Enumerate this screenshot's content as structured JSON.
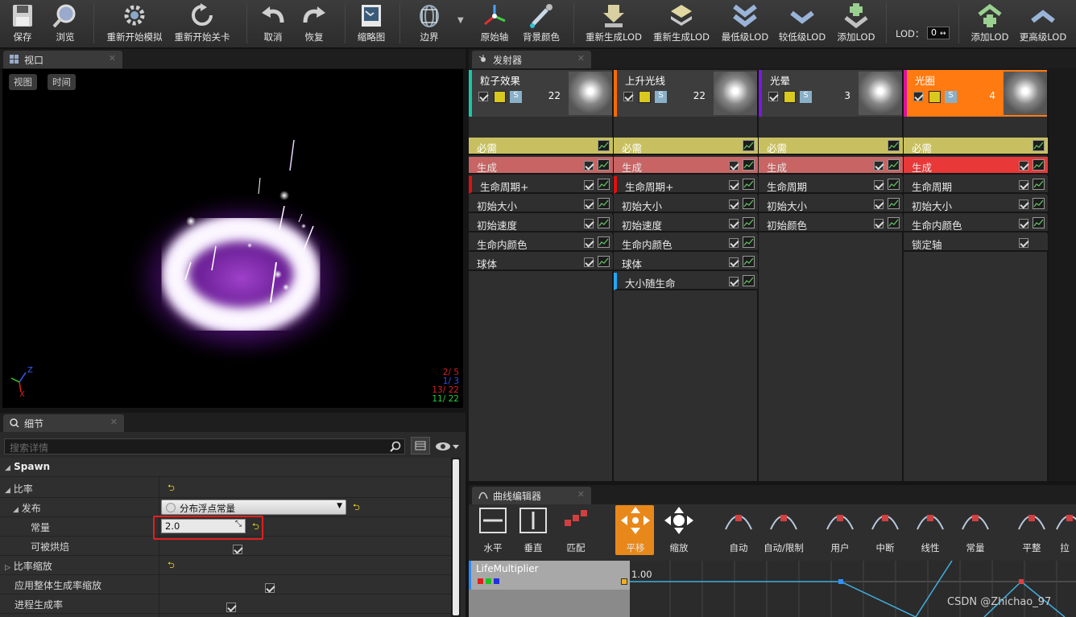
{
  "toolbar": {
    "save": "保存",
    "browse": "浏览",
    "restart_sim": "重新开始模拟",
    "restart_level": "重新开始关卡",
    "undo": "取消",
    "redo": "恢复",
    "thumbnail": "缩略图",
    "bounds": "边界",
    "origin_axis": "原始轴",
    "bg_color": "背景颜色",
    "regen_lod1": "重新生成LOD",
    "regen_lod2": "重新生成LOD",
    "lowest_lod": "最低级LOD",
    "lower_lod": "较低级LOD",
    "add_lod1": "添加LOD",
    "lod_label": "LOD：",
    "lod_value": "0",
    "add_lod2": "添加LOD",
    "higher_lod": "更高级LOD"
  },
  "viewport": {
    "tab": "视口",
    "view_btn": "视图",
    "time_btn": "时间",
    "stats": [
      {
        "a": "2/",
        "b": "5",
        "color": "#d02020"
      },
      {
        "a": "1/",
        "b": "3",
        "color": "#3050e0"
      },
      {
        "a": "13/",
        "b": "22",
        "color": "#e02020"
      },
      {
        "a": "11/",
        "b": "22",
        "color": "#20d040"
      }
    ],
    "axis": {
      "z": "Z",
      "x": "X"
    }
  },
  "details": {
    "tab": "细节",
    "search_placeholder": "搜索详情",
    "section": "Spawn",
    "rows": [
      {
        "label": "比率"
      },
      {
        "label": "发布",
        "value": "分布浮点常量"
      },
      {
        "label": "常量",
        "value": "2.0"
      },
      {
        "label": "可被烘焙"
      },
      {
        "label": "比率缩放"
      },
      {
        "label": "应用整体生成率缩放"
      },
      {
        "label": "进程生成率"
      }
    ]
  },
  "emitters_tab": "发射器",
  "emitters": [
    {
      "name": "粒子效果",
      "count": "22",
      "color": "#17c9a8",
      "modules": [
        "必需",
        "生成",
        "生命周期+",
        "初始大小",
        "初始速度",
        "生命内颜色",
        "球体"
      ]
    },
    {
      "name": "上升光线",
      "count": "22",
      "color": "#ff6a00",
      "modules": [
        "必需",
        "生成",
        "生命周期+",
        "初始大小",
        "初始速度",
        "生命内颜色",
        "球体",
        "大小随生命"
      ]
    },
    {
      "name": "光晕",
      "count": "3",
      "color": "#7a18e0",
      "modules": [
        "必需",
        "生成",
        "生命周期",
        "初始大小",
        "初始颜色"
      ]
    },
    {
      "name": "光圈",
      "count": "4",
      "color": "#e010a0",
      "modules": [
        "必需",
        "生成",
        "生命周期",
        "初始大小",
        "生命内颜色",
        "锁定轴"
      ]
    }
  ],
  "curve_editor": {
    "tab": "曲线编辑器",
    "buttons": [
      "水平",
      "垂直",
      "匹配",
      "平移",
      "缩放",
      "自动",
      "自动/限制",
      "用户",
      "中断",
      "线性",
      "常量",
      "平整",
      "拉"
    ],
    "track": "LifeMultiplier",
    "value_label": "1.00"
  },
  "watermark": "CSDN @Zhichao_97",
  "colors": {
    "accent_orange": "#e8881a",
    "required": "#c8c060",
    "spawn": "#c86464",
    "spawn_active": "#e83838",
    "panel": "#2f2f2f"
  }
}
